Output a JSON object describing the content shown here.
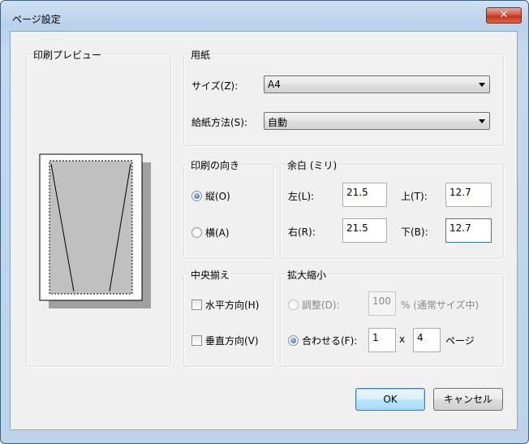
{
  "window": {
    "title": "ページ設定",
    "close_glyph": "✕"
  },
  "preview": {
    "group_label": "印刷プレビュー"
  },
  "paper": {
    "group_label": "用紙",
    "size_label": "サイズ(Z):",
    "size_value": "A4",
    "source_label": "給紙方法(S):",
    "source_value": "自動"
  },
  "orientation": {
    "group_label": "印刷の向き",
    "portrait_label": "縦(O)",
    "landscape_label": "横(A)",
    "selected": "portrait"
  },
  "margins": {
    "group_label": "余白 (ミリ)",
    "left_label": "左(L):",
    "left_value": "21.5",
    "top_label": "上(T):",
    "top_value": "12.7",
    "right_label": "右(R):",
    "right_value": "21.5",
    "bottom_label": "下(B):",
    "bottom_value": "12.7"
  },
  "centering": {
    "group_label": "中央揃え",
    "horizontal_label": "水平方向(H)",
    "vertical_label": "垂直方向(V)"
  },
  "scaling": {
    "group_label": "拡大縮小",
    "adjust_label": "調整(D):",
    "adjust_value": "100",
    "adjust_suffix": "% (通常サイズ中)",
    "fit_label": "合わせる(F):",
    "fit_wide": "1",
    "fit_x": "x",
    "fit_tall": "4",
    "fit_suffix": "ページ",
    "selected": "fit"
  },
  "buttons": {
    "ok": "OK",
    "cancel": "キャンセル"
  }
}
